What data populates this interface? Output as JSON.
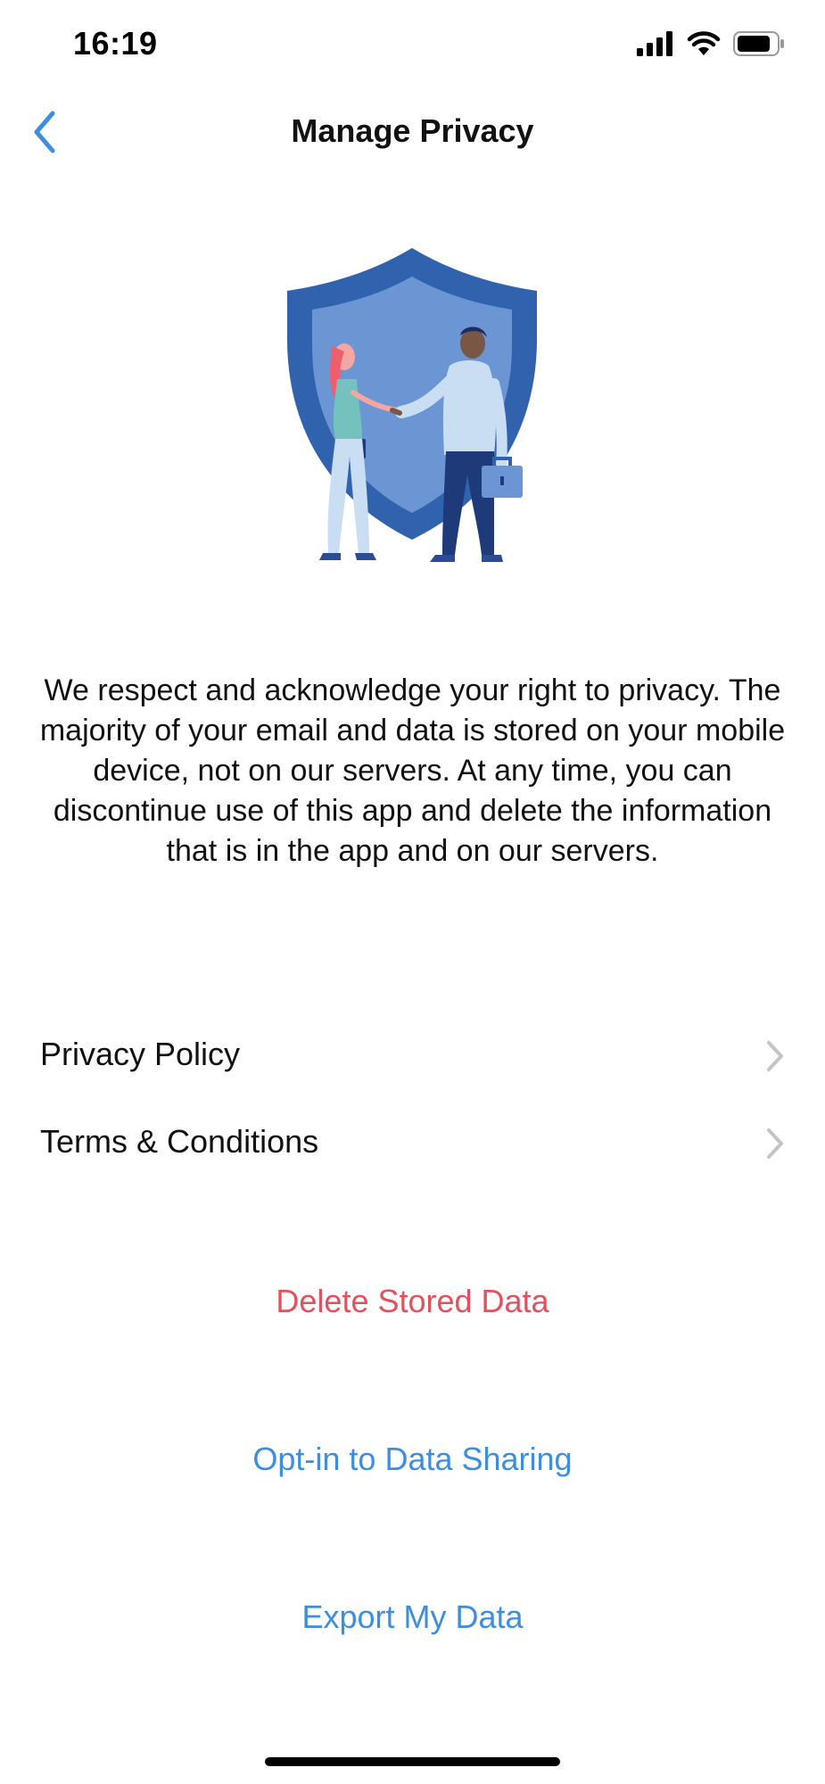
{
  "status_bar": {
    "time": "16:19",
    "icons": [
      "cellular-signal-icon",
      "wifi-icon",
      "battery-icon"
    ]
  },
  "nav": {
    "title": "Manage Privacy",
    "back_icon": "chevron-left-icon"
  },
  "hero": {
    "illustration": "shield-handshake-illustration"
  },
  "description": "We respect and acknowledge your right to privacy. The majority of your email and data is stored on your mobile device, not on our servers. At any time, you can discontinue use of this app and delete the information that is in the app and on our servers.",
  "menu": {
    "items": [
      {
        "label": "Privacy Policy",
        "icon": "chevron-right-icon"
      },
      {
        "label": "Terms & Conditions",
        "icon": "chevron-right-icon"
      }
    ]
  },
  "actions": {
    "delete": "Delete Stored Data",
    "opt_in": "Opt-in to Data Sharing",
    "export": "Export My Data"
  },
  "colors": {
    "accent_blue": "#3E8EE0",
    "destructive_red": "#E0525E",
    "chevron_gray": "#C4C4C6",
    "shield_dark": "#3062AE",
    "shield_light": "#6B95D3"
  }
}
